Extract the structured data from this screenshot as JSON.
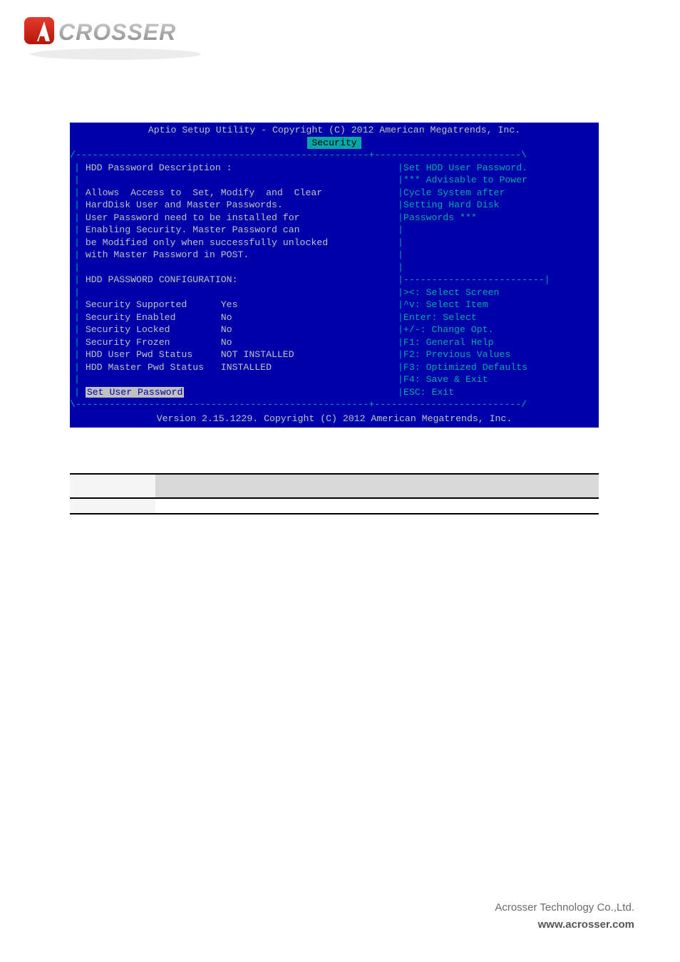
{
  "logo": {
    "text": "ACROSSER"
  },
  "bios": {
    "header": "Aptio Setup Utility - Copyright (C) 2012 American Megatrends, Inc.",
    "tab": "Security",
    "topRule": "/----------------------------------------------------+--------------------------\\",
    "rows": [
      {
        "l": "HDD Password Description :",
        "r": "|Set HDD User Password."
      },
      {
        "l": "",
        "r": "|*** Advisable to Power"
      },
      {
        "l": "Allows  Access to  Set, Modify  and  Clear",
        "r": "|Cycle System after"
      },
      {
        "l": "HardDisk User and Master Passwords.",
        "r": "|Setting Hard Disk"
      },
      {
        "l": "User Password need to be installed for",
        "r": "|Passwords ***"
      },
      {
        "l": "Enabling Security. Master Password can",
        "r": "|"
      },
      {
        "l": "be Modified only when successfully unlocked",
        "r": "|"
      },
      {
        "l": "with Master Password in POST.",
        "r": "|"
      },
      {
        "l": "",
        "r": "|"
      },
      {
        "l": "HDD PASSWORD CONFIGURATION:",
        "r": "|-------------------------|"
      },
      {
        "l": "",
        "r": "|><: Select Screen"
      },
      {
        "l": "Security Supported      Yes",
        "r": "|^v: Select Item"
      },
      {
        "l": "Security Enabled        No",
        "r": "|Enter: Select"
      },
      {
        "l": "Security Locked         No",
        "r": "|+/-: Change Opt."
      },
      {
        "l": "Security Frozen         No",
        "r": "|F1: General Help"
      },
      {
        "l": "HDD User Pwd Status     NOT INSTALLED",
        "r": "|F2: Previous Values"
      },
      {
        "l": "HDD Master Pwd Status   INSTALLED",
        "r": "|F3: Optimized Defaults"
      },
      {
        "l": "",
        "r": "|F4: Save & Exit"
      }
    ],
    "selectedRow": {
      "l": "Set User Password",
      "r": "|ESC: Exit"
    },
    "bottomRule": "\\----------------------------------------------------+--------------------------/",
    "footer": "Version 2.15.1229. Copyright (C) 2012 American Megatrends, Inc."
  },
  "table": {
    "headers": [
      "",
      "",
      ""
    ],
    "row": {
      "c1": "",
      "c2": "",
      "c3": ""
    }
  },
  "footerText": {
    "company": "Acrosser Technology Co.,Ltd.",
    "site": "www.acrosser.com"
  }
}
